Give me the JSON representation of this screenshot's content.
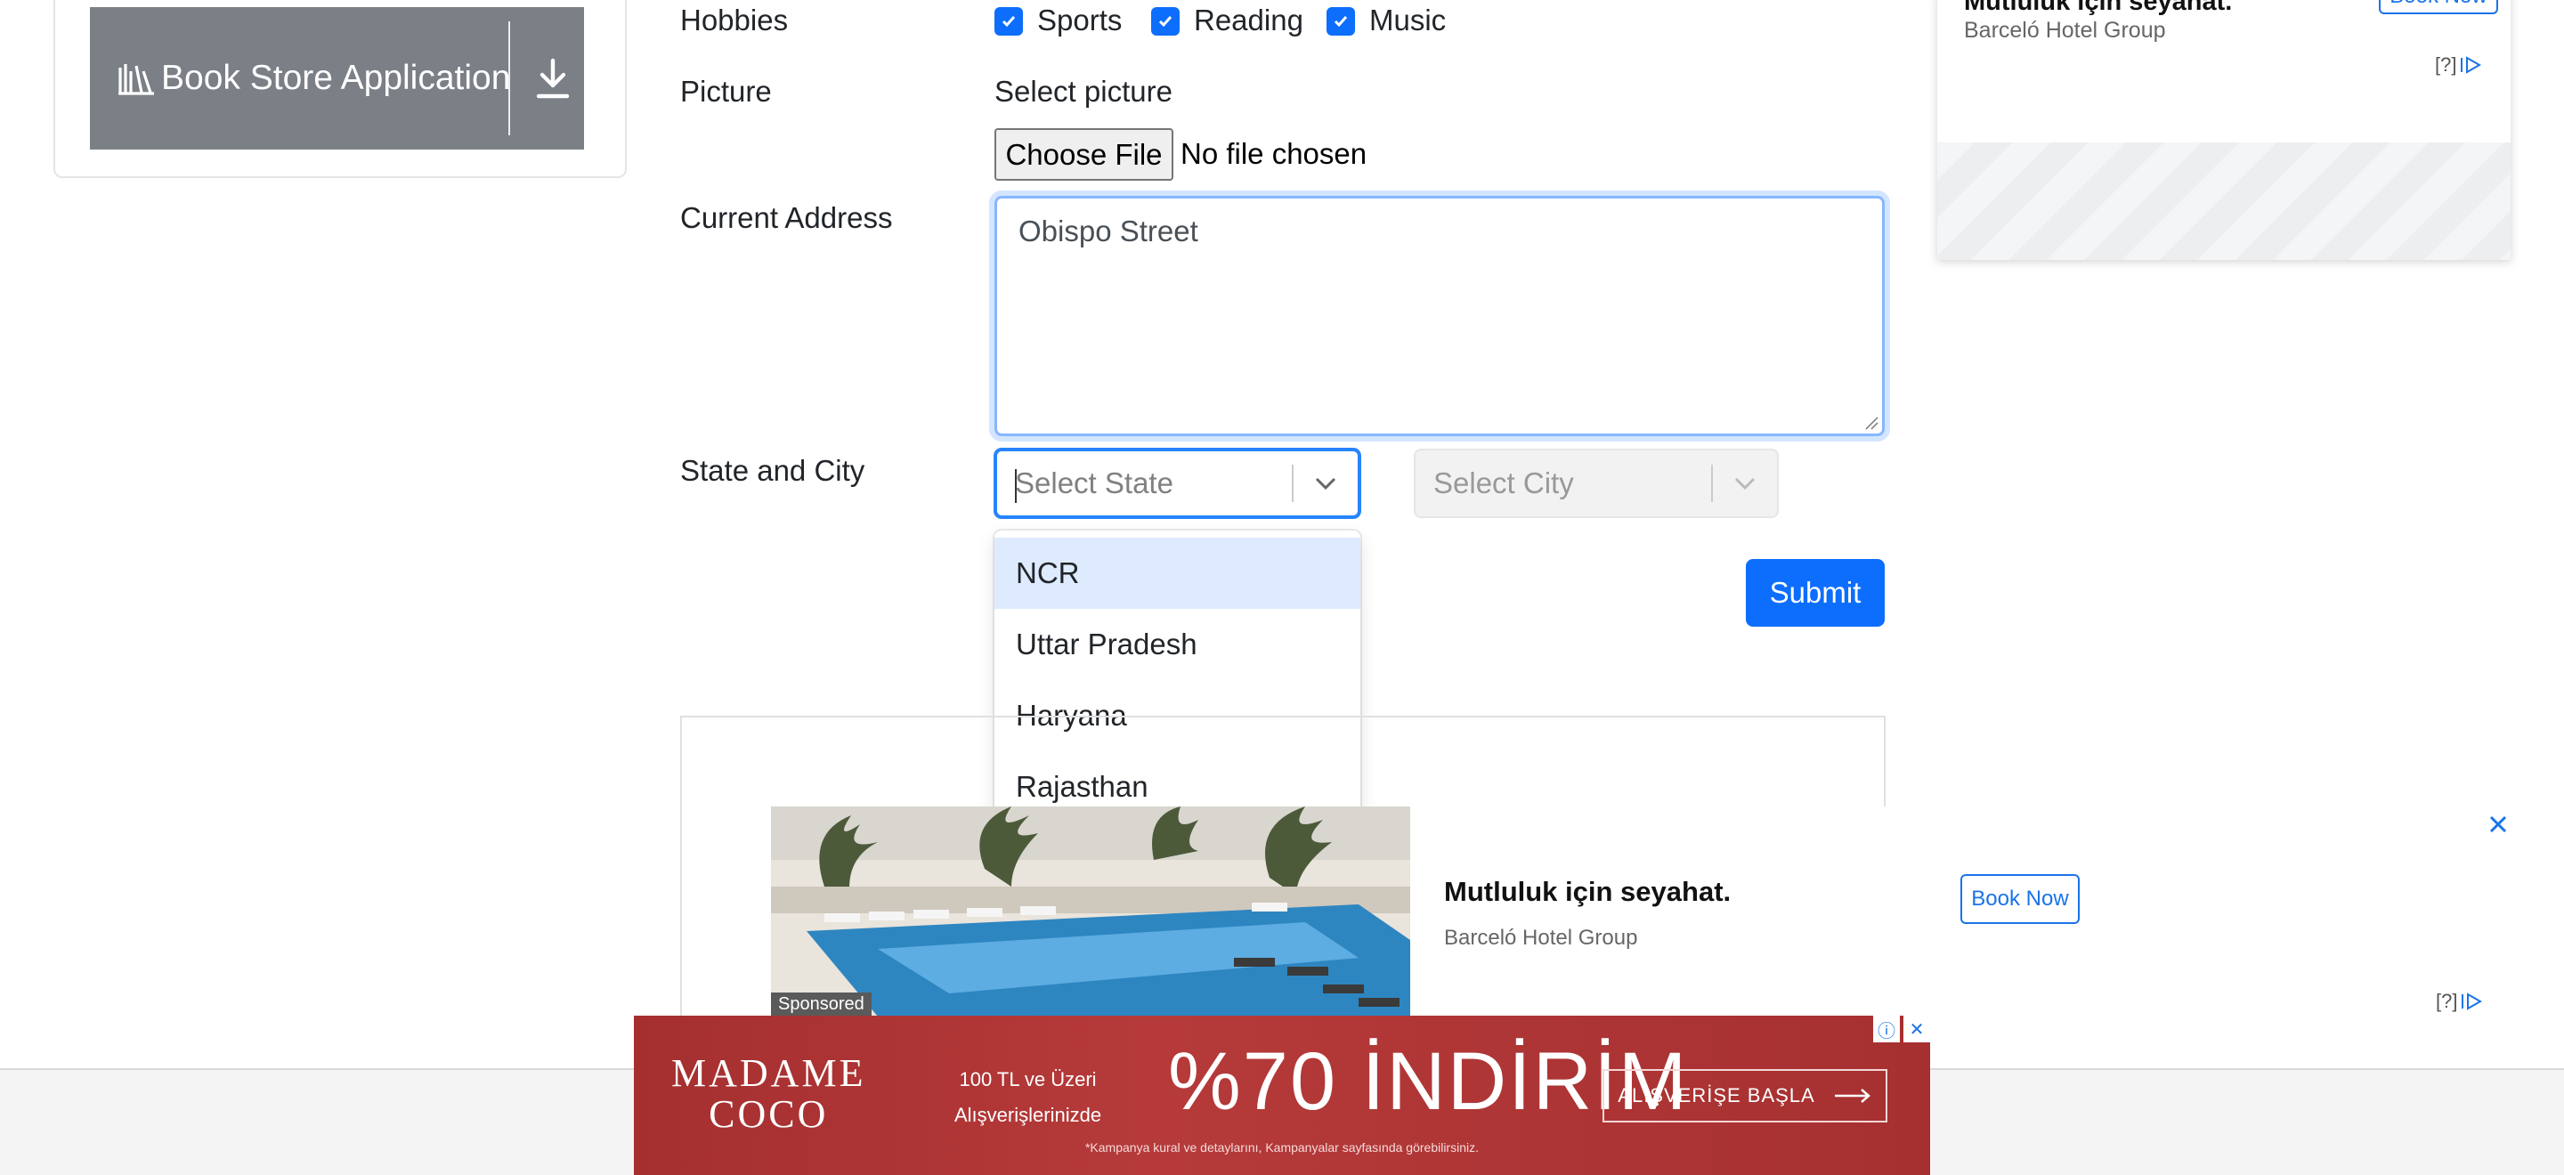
{
  "sidebar": {
    "book_store_label": "Book Store Application"
  },
  "form": {
    "hobbies_label": "Hobbies",
    "hobbies": [
      {
        "label": "Sports",
        "checked": true
      },
      {
        "label": "Reading",
        "checked": true
      },
      {
        "label": "Music",
        "checked": true
      }
    ],
    "picture_label": "Picture",
    "picture_hint": "Select picture",
    "choose_file_label": "Choose File",
    "file_status": "No file chosen",
    "address_label": "Current Address",
    "address_value": "Obispo Street",
    "state_city_label": "State and City",
    "state_placeholder": "Select State",
    "city_placeholder": "Select City",
    "state_options": [
      "NCR",
      "Uttar Pradesh",
      "Haryana",
      "Rajasthan"
    ],
    "submit_label": "Submit"
  },
  "ads": {
    "top": {
      "title": "Mutluluk için seyahat.",
      "brand": "Barceló Hotel Group",
      "book_label": "Book Now",
      "choices": "[?]"
    },
    "sponsored": {
      "badge": "Sponsored",
      "title": "Mutluluk için seyahat.",
      "brand": "Barceló Hotel Group",
      "book_label": "Book Now",
      "choices": "[?]"
    },
    "banner": {
      "brand_line1": "MADAME",
      "brand_line2": "COCO",
      "small_line1": "100 TL ve Üzeri",
      "small_line2": "Alışverişlerinizde",
      "headline": "%70 İNDİRİM",
      "cta": "ALIŞVERİŞE BAŞLA",
      "terms": "*Kampanya kural ve detaylarını, Kampanyalar sayfasında görebilirsiniz."
    }
  },
  "colors": {
    "primary": "#0d6efd",
    "sidebar_item": "#7b8086",
    "focus_border": "#86b7fe",
    "option_focus": "#deebff",
    "banner_red": "#b63a3a"
  }
}
